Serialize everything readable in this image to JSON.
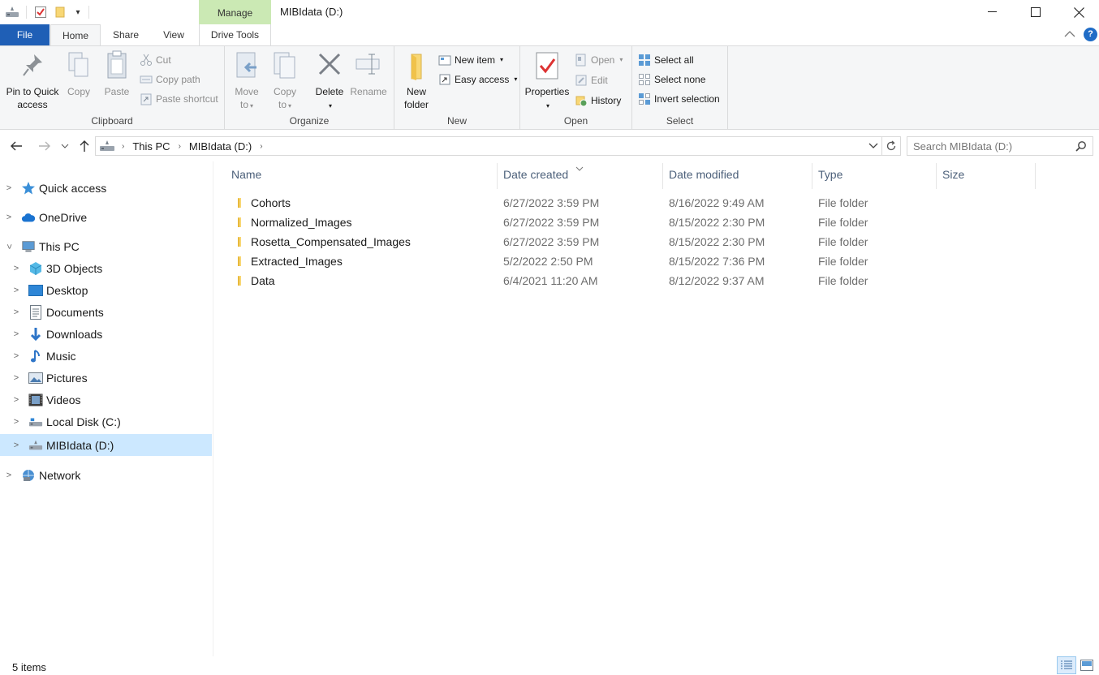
{
  "window": {
    "title": "MIBIdata (D:)",
    "context_tab": "Manage"
  },
  "tabs": {
    "file": "File",
    "home": "Home",
    "share": "Share",
    "view": "View",
    "drive_tools": "Drive Tools"
  },
  "ribbon": {
    "clipboard": {
      "label": "Clipboard",
      "pin_line1": "Pin to Quick",
      "pin_line2": "access",
      "copy": "Copy",
      "paste": "Paste",
      "cut": "Cut",
      "copy_path": "Copy path",
      "paste_shortcut": "Paste shortcut"
    },
    "organize": {
      "label": "Organize",
      "move_line1": "Move",
      "move_line2": "to",
      "copy_line1": "Copy",
      "copy_line2": "to",
      "delete": "Delete",
      "rename": "Rename"
    },
    "new": {
      "label": "New",
      "new_folder_line1": "New",
      "new_folder_line2": "folder",
      "new_item": "New item",
      "easy_access": "Easy access"
    },
    "open": {
      "label": "Open",
      "properties": "Properties",
      "open": "Open",
      "edit": "Edit",
      "history": "History"
    },
    "select": {
      "label": "Select",
      "select_all": "Select all",
      "select_none": "Select none",
      "invert_selection": "Invert selection"
    }
  },
  "address": {
    "crumbs": [
      "This PC",
      "MIBIdata (D:)"
    ],
    "search_placeholder": "Search MIBIdata (D:)"
  },
  "navigation": [
    {
      "label": "Quick access",
      "icon": "star-icon"
    },
    {
      "label": "OneDrive",
      "icon": "cloud-icon"
    },
    {
      "label": "This PC",
      "icon": "computer-icon"
    },
    {
      "label": "3D Objects",
      "icon": "cube-icon"
    },
    {
      "label": "Desktop",
      "icon": "desktop-icon"
    },
    {
      "label": "Documents",
      "icon": "document-icon"
    },
    {
      "label": "Downloads",
      "icon": "download-icon"
    },
    {
      "label": "Music",
      "icon": "music-icon"
    },
    {
      "label": "Pictures",
      "icon": "pictures-icon"
    },
    {
      "label": "Videos",
      "icon": "video-icon"
    },
    {
      "label": "Local Disk (C:)",
      "icon": "disk-icon"
    },
    {
      "label": "MIBIdata (D:)",
      "icon": "drive-icon"
    },
    {
      "label": "Network",
      "icon": "network-icon"
    }
  ],
  "columns": {
    "name": "Name",
    "date_created": "Date created",
    "date_modified": "Date modified",
    "type": "Type",
    "size": "Size"
  },
  "files": [
    {
      "name": "Cohorts",
      "created": "6/27/2022 3:59 PM",
      "modified": "8/16/2022 9:49 AM",
      "type": "File folder"
    },
    {
      "name": "Normalized_Images",
      "created": "6/27/2022 3:59 PM",
      "modified": "8/15/2022 2:30 PM",
      "type": "File folder"
    },
    {
      "name": "Rosetta_Compensated_Images",
      "created": "6/27/2022 3:59 PM",
      "modified": "8/15/2022 2:30 PM",
      "type": "File folder"
    },
    {
      "name": "Extracted_Images",
      "created": "5/2/2022 2:50 PM",
      "modified": "8/15/2022 7:36 PM",
      "type": "File folder"
    },
    {
      "name": "Data",
      "created": "6/4/2021 11:20 AM",
      "modified": "8/12/2022 9:37 AM",
      "type": "File folder"
    }
  ],
  "status": {
    "item_count": "5 items"
  },
  "colors": {
    "file_tab": "#1f5fb6",
    "manage_tab": "#cbe9b4",
    "selection": "#cce8ff",
    "folder": "#f8d775"
  }
}
